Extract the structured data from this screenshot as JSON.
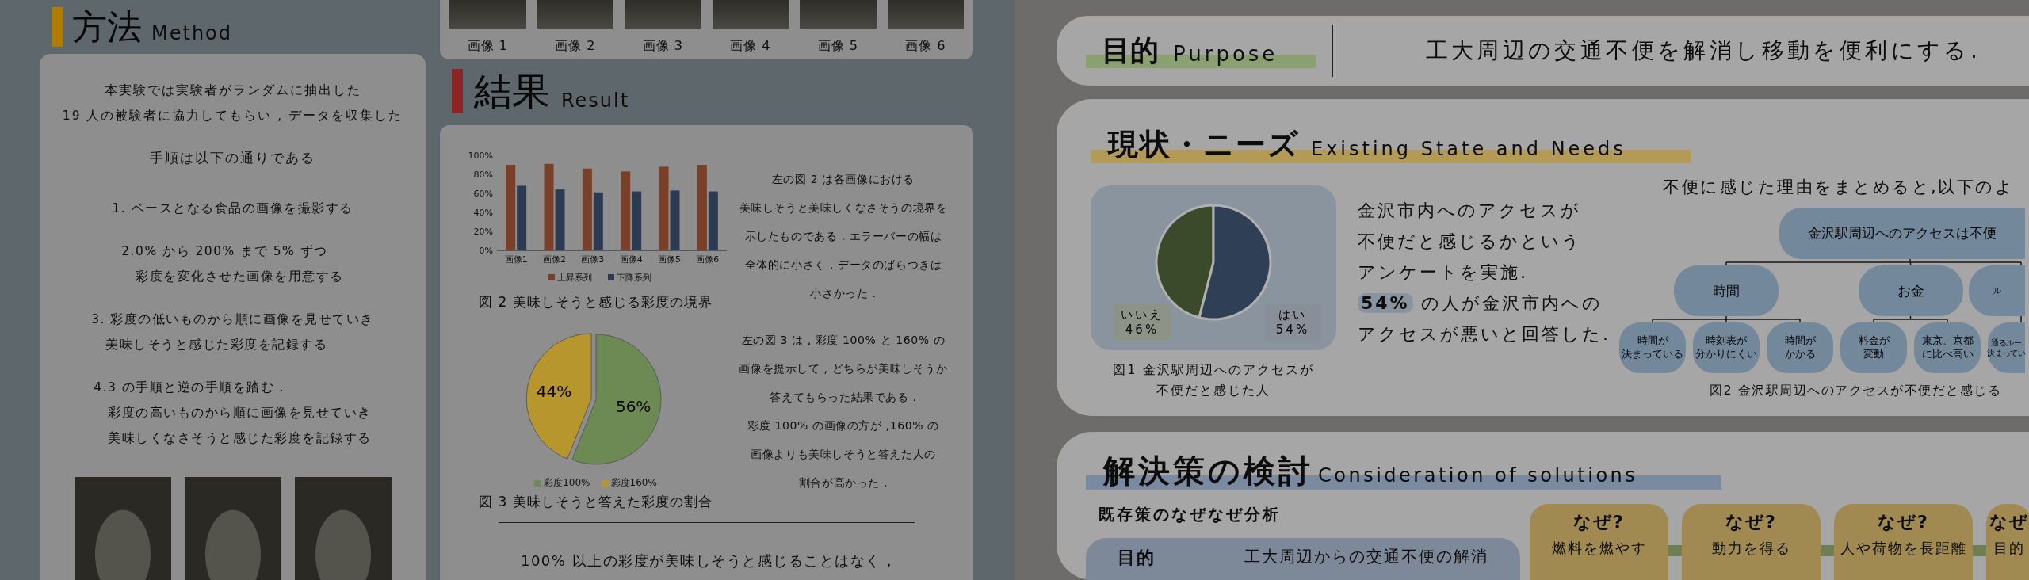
{
  "method": {
    "heading": "方法",
    "heading_en": "Method",
    "intro": [
      "本実験では実験者がランダムに抽出した",
      "19 人の被験者に協力してもらい , データを収集した"
    ],
    "lead": "手順は以下の通りである",
    "steps": [
      [
        "1. ベースとなる食品の画像を撮影する"
      ],
      [
        "2.0% から 200% まで 5% ずつ",
        "彩度を変化させた画像を用意する"
      ],
      [
        "3. 彩度の低いものから順に画像を見せていき",
        "美味しそうと感じた彩度を記録する"
      ],
      [
        "4.3 の手順と逆の手順を踏む .",
        "彩度の高いものから順に画像を見せていき",
        "美味しくなさそうと感じた彩度を記録する"
      ]
    ]
  },
  "images": {
    "captions": [
      "画像 1",
      "画像 2",
      "画像 3",
      "画像 4",
      "画像 5",
      "画像 6"
    ]
  },
  "result": {
    "heading": "結果",
    "heading_en": "Result",
    "bar_chart": {
      "chart_data": {
        "type": "bar",
        "categories": [
          "画像1",
          "画像2",
          "画像3",
          "画像4",
          "画像5",
          "画像6"
        ],
        "series": [
          {
            "name": "上昇系列",
            "color": "#7a3f28",
            "values": [
              90,
              91,
              86,
              83,
              88,
              90
            ]
          },
          {
            "name": "下降系列",
            "color": "#2c3a52",
            "values": [
              68,
              64,
              61,
              62,
              63,
              62
            ]
          }
        ],
        "legend": "bottom",
        "ylim": [
          0,
          100
        ],
        "yticks": [
          {
            "value": 0,
            "label": "0%"
          },
          {
            "value": 20,
            "label": "20%"
          },
          {
            "value": 40,
            "label": "40%"
          },
          {
            "value": 60,
            "label": "60%"
          },
          {
            "value": 80,
            "label": "80%"
          },
          {
            "value": 100,
            "label": "100%"
          }
        ]
      },
      "caption": "図 2 美味しそうと感じる彩度の境界",
      "text": [
        "左の図 2 は各画像における",
        "美味しそうと美味しくなさそうの境界を",
        "示したものである . エラーバーの幅は",
        "全体的に小さく , データのばらつきは",
        "小さかった ."
      ]
    },
    "pie_chart": {
      "chart_data": {
        "type": "pie",
        "categories": [
          "彩度100%",
          "彩度160%"
        ],
        "values": [
          56,
          44
        ],
        "colors": [
          "#6d8a55",
          "#b8962e"
        ],
        "value_labels": [
          "56%",
          "44%"
        ]
      },
      "caption": "図 3 美味しそうと答えた彩度の割合",
      "text": [
        "左の図 3 は , 彩度 100% と 160% の",
        "画像を提示して , どちらが美味しそうか",
        "答えてもらった結果である .",
        "彩度 100% の画像の方が ,160% の",
        "画像よりも美味しそうと答えた人の",
        "割合が高かった ."
      ]
    },
    "conclusion": "100% 以上の彩度が美味しそうと感じることはなく ,"
  },
  "purpose": {
    "heading": "目的",
    "heading_en": "Purpose",
    "statement": "工大周辺の交通不便を解消し移動を便利にする."
  },
  "needs": {
    "heading": "現状・ニーズ",
    "heading_en": "Existing State and Needs",
    "chart_data": {
      "type": "pie",
      "categories": [
        "いいえ",
        "はい"
      ],
      "values": [
        46,
        54
      ],
      "colors": [
        "#3a4a2a",
        "#2f3f55"
      ],
      "value_labels": [
        "46%",
        "54%"
      ]
    },
    "caption": [
      "図1 金沢駅周辺へのアクセスが",
      "不便だと感じた人"
    ],
    "text": [
      "金沢市内へのアクセスが",
      "不便だと感じるかという",
      "アンケートを実施.",
      "**54%** の人が金沢市内への",
      "アクセスが悪いと回答した."
    ],
    "summary": "不便に感じた理由をまとめると,以下のよ",
    "tree": {
      "lines": [
        "金沢駅周辺へのアクセスは不便"
      ],
      "children": [
        {
          "lines": [
            "時間"
          ],
          "children": [
            {
              "lines": [
                "時間が",
                "決まっている"
              ]
            },
            {
              "lines": [
                "時刻表が",
                "分かりにくい"
              ]
            },
            {
              "lines": [
                "時間が",
                "かかる"
              ]
            }
          ]
        },
        {
          "lines": [
            "お金"
          ],
          "children": [
            {
              "lines": [
                "料金が",
                "変動"
              ]
            },
            {
              "lines": [
                "東京、京都",
                "に比べ高い"
              ]
            }
          ]
        },
        {
          "lines": [
            "ル"
          ],
          "children": [
            {
              "lines": [
                "通るルー",
                "決まってい"
              ]
            }
          ]
        }
      ]
    },
    "tree_caption": "図2 金沢駅周辺へのアクセスが不便だと感じる"
  },
  "solutions": {
    "heading": "解決策の検討",
    "heading_en": "Consideration of solutions",
    "subheading": "既存策のなぜなぜ分析",
    "goal": {
      "label": "目的",
      "text": "工大周辺からの交通不便の解消"
    },
    "whys": [
      {
        "title": "なぜ?",
        "text": "燃料を燃やす"
      },
      {
        "title": "なぜ?",
        "text": "動力を得る"
      },
      {
        "title": "なぜ?",
        "text": "人や荷物を長距離"
      },
      {
        "title": "なぜ",
        "text": "目的"
      }
    ]
  }
}
